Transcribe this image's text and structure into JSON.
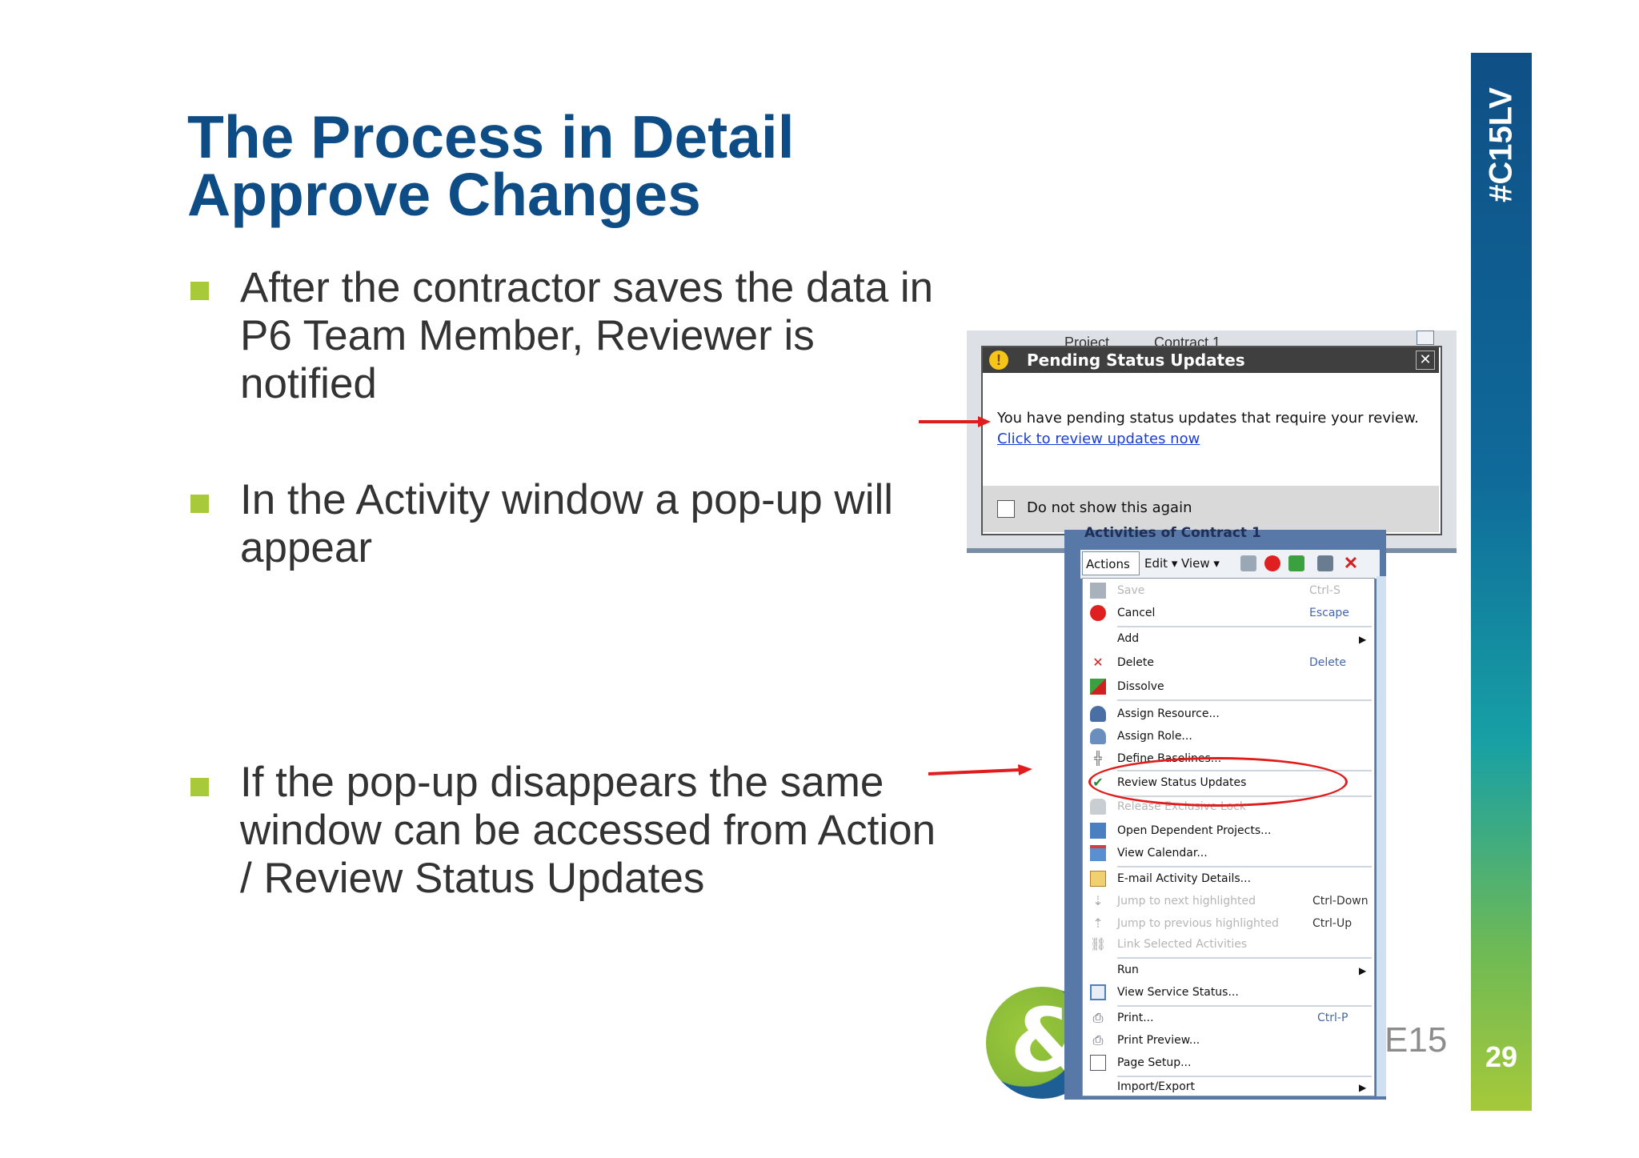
{
  "slide": {
    "title_line1": "The Process in Detail",
    "title_line2": "Approve Changes",
    "bullets": [
      {
        "lines": [
          "After the contractor saves the data in",
          "P6 Team Member, Reviewer is",
          "notified"
        ]
      },
      {
        "lines": [
          "In the Activity window a pop-up will",
          "appear"
        ]
      },
      {
        "lines": [
          "If the pop-up disappears the same",
          "window can be accessed from Action",
          "/  Review Status Updates"
        ]
      }
    ],
    "side_tag": "#C15LV",
    "page_number": "29",
    "logo_suffix": "E15",
    "colors": {
      "title": "#0e4c86",
      "bullet": "#a8c93a",
      "arrow": "#e01c1c"
    }
  },
  "pending_dialog": {
    "crumb_project": "Project",
    "crumb_contract": "Contract 1",
    "title": "Pending Status Updates",
    "message": "You have pending status updates that require your review.",
    "link": "Click to review updates now",
    "checkbox_label": "Do not show this again",
    "close_glyph": "✕",
    "warn_glyph": "!"
  },
  "activities_menu": {
    "window_title": "Activities of Contract 1",
    "toolbar": {
      "actions": "Actions ▾",
      "edit": "Edit ▾",
      "view": "View ▾"
    },
    "items": [
      {
        "label": "Save",
        "shortcut": "Ctrl-S",
        "disabled": true,
        "icon": "save-icon"
      },
      {
        "label": "Cancel",
        "shortcut": "Escape",
        "icon": "cancel-icon"
      },
      {
        "label": "Add",
        "submenu": "▶"
      },
      {
        "label": "Delete",
        "shortcut": "Delete",
        "icon": "delete-icon"
      },
      {
        "label": "Dissolve",
        "icon": "dissolve-icon"
      },
      {
        "label": "Assign Resource...",
        "icon": "resource-icon"
      },
      {
        "label": "Assign Role...",
        "icon": "role-icon"
      },
      {
        "label": "Define Baselines...",
        "icon": "baseline-icon"
      },
      {
        "label": "Review Status Updates",
        "icon": "review-icon"
      },
      {
        "label": "Release Exclusive Lock",
        "disabled": true,
        "icon": "lock-icon"
      },
      {
        "label": "Open Dependent Projects...",
        "icon": "projects-icon"
      },
      {
        "label": "View Calendar...",
        "icon": "calendar-icon"
      },
      {
        "label": "E-mail Activity Details...",
        "icon": "email-icon"
      },
      {
        "label": "Jump to next highlighted",
        "shortcut": "Ctrl-Down",
        "disabled": true,
        "icon": "jump-next-icon"
      },
      {
        "label": "Jump to previous highlighted",
        "shortcut": "Ctrl-Up",
        "disabled": true,
        "icon": "jump-prev-icon"
      },
      {
        "label": "Link Selected Activities",
        "disabled": true,
        "icon": "link-icon"
      },
      {
        "label": "Run",
        "submenu": "▶"
      },
      {
        "label": "View Service Status...",
        "icon": "service-icon"
      },
      {
        "label": "Print...",
        "shortcut": "Ctrl-P",
        "icon": "print-icon"
      },
      {
        "label": "Print Preview...",
        "icon": "print-preview-icon"
      },
      {
        "label": "Page Setup...",
        "icon": "page-setup-icon"
      },
      {
        "label": "Import/Export",
        "submenu": "▶"
      }
    ]
  }
}
